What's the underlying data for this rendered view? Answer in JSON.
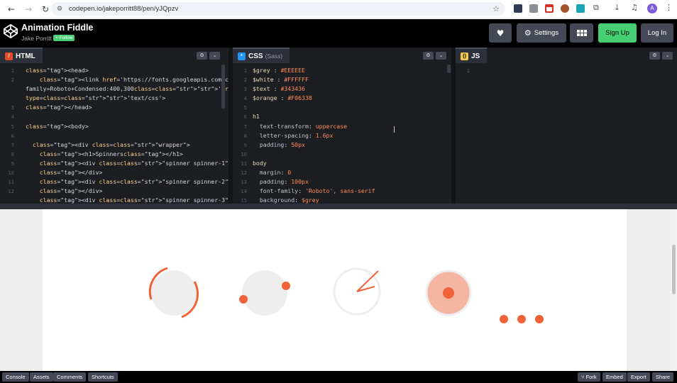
{
  "browser": {
    "url": "codepen.io/jakeporritt88/pen/yJQpzv",
    "profile_initial": "A"
  },
  "header": {
    "title": "Animation Fiddle",
    "author": "Jake Porritt",
    "follow_label": "+ Follow",
    "settings_label": "Settings",
    "signup_label": "Sign Up",
    "login_label": "Log In"
  },
  "editors": {
    "html": {
      "name": "HTML",
      "line_numbers": [
        "1",
        "2",
        "",
        "",
        "3",
        "4",
        "5",
        "6",
        "7",
        "8",
        "9",
        "10",
        "11",
        "12"
      ],
      "lines": [
        "<head>",
        "    <link href='https://fonts.googleapis.com/css?",
        "family=Roboto+Condensed:400,300' rel='stylesheet'",
        "type='text/css'>",
        "</head>",
        "",
        "<body>",
        "",
        "  <div class=\"wrapper\">",
        "    <h1>Spinners</h1>",
        "    <div class=\"spinner spinner-1\">",
        "    </div>",
        "    <div class=\"spinner spinner-2\">",
        "    </div>",
        "    <div class=\"spinner spinner-3\">"
      ]
    },
    "css": {
      "name": "CSS",
      "sub": "(Sass)",
      "line_numbers": [
        "1",
        "2",
        "3",
        "4",
        "5",
        "6",
        "7",
        "8",
        "9",
        "10",
        "11",
        "12",
        "13",
        "14",
        "15"
      ],
      "lines": [
        "$grey : #EEEEEE",
        "$white : #FFFFFF",
        "$text : #343436",
        "$orange : #F06338",
        "",
        "h1",
        "  text-transform: uppercase",
        "  letter-spacing: 1.6px",
        "  padding: 50px",
        "",
        "body",
        "  margin: 0",
        "  padding: 100px",
        "  font-family: 'Roboto', sans-serif",
        "  background: $grey"
      ]
    },
    "js": {
      "name": "JS",
      "line_numbers": [
        "1"
      ]
    }
  },
  "bottom_bar": {
    "console": "Console",
    "assets": "Assets",
    "comments": "Comments",
    "shortcuts": "Shortcuts",
    "fork": "Fork",
    "embed": "Embed",
    "export": "Export",
    "share": "Share"
  },
  "colors": {
    "accent_orange": "#F06338",
    "grey": "#EEEEEE",
    "signup_green": "#47CF73"
  },
  "icons": {
    "heart": "heart-icon",
    "settings": "gear-icon",
    "layout": "layout-grid-icon",
    "fork": "fork-icon"
  }
}
